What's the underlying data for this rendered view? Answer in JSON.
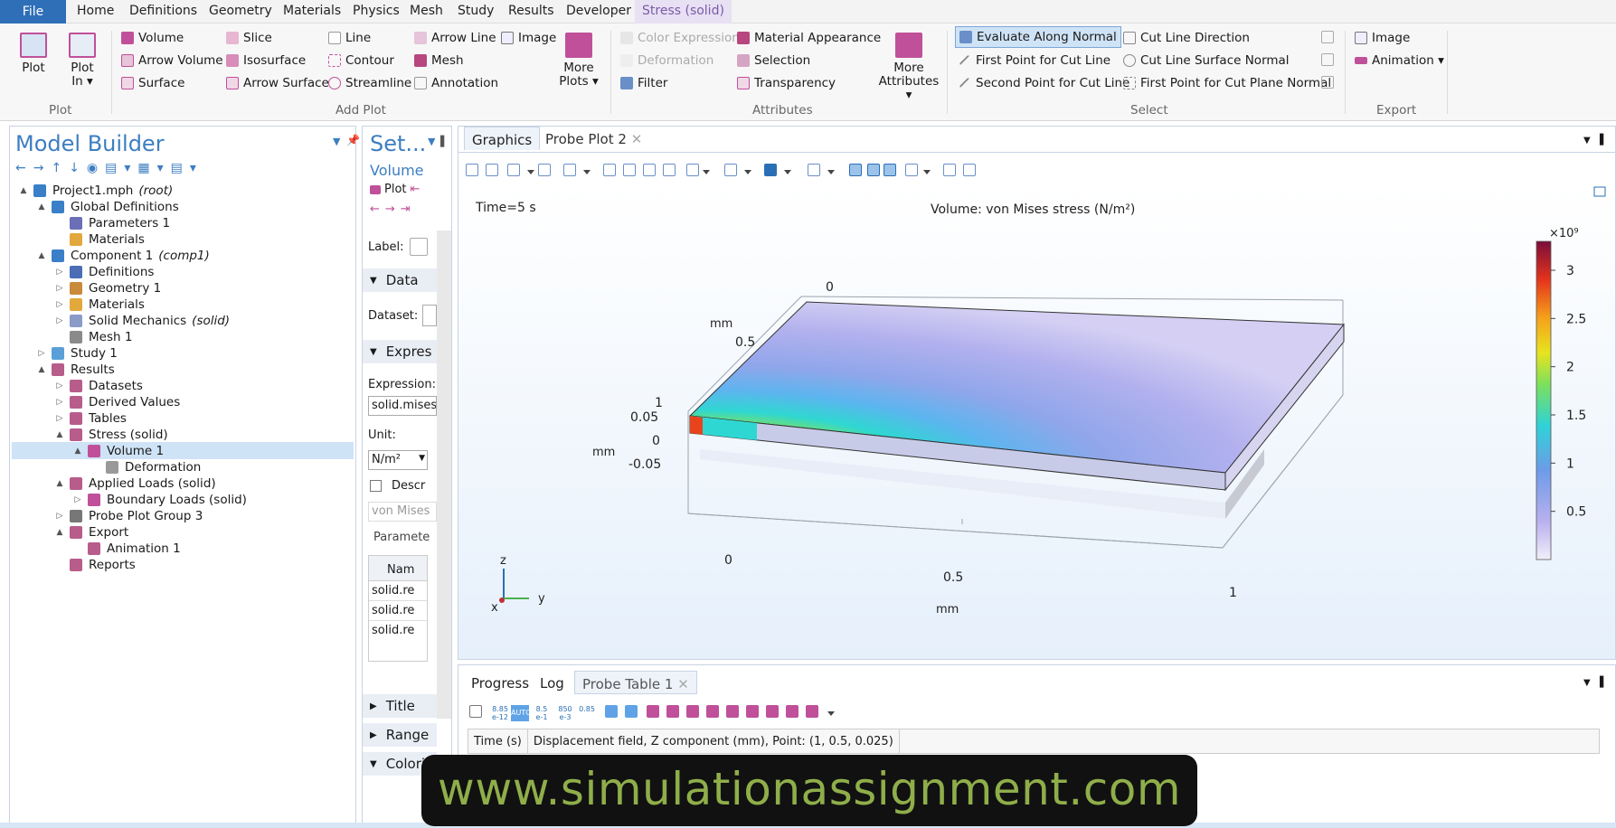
{
  "menu": {
    "file": "File",
    "items": [
      "Home",
      "Definitions",
      "Geometry",
      "Materials",
      "Physics",
      "Mesh",
      "Study",
      "Results",
      "Developer"
    ],
    "context_tab": "Stress (solid)"
  },
  "ribbon": {
    "plot_group": {
      "plot": "Plot",
      "plot_in": "Plot In ▾",
      "label": "Plot"
    },
    "add_plot": {
      "col1": [
        "Volume",
        "Arrow Volume",
        "Surface"
      ],
      "col2": [
        "Slice",
        "Isosurface",
        "Arrow Surface"
      ],
      "col3": [
        "Line",
        "Contour",
        "Streamline"
      ],
      "col4": [
        "Arrow Line",
        "Mesh",
        "Annotation"
      ],
      "image": "Image",
      "more_plots": "More Plots ▾",
      "label": "Add Plot"
    },
    "attributes": {
      "col1": [
        "Color Expression",
        "Deformation",
        "Filter"
      ],
      "col2": [
        "Material Appearance",
        "Selection",
        "Transparency"
      ],
      "more": "More Attributes ▾",
      "label": "Attributes"
    },
    "select": {
      "col1": [
        "Evaluate Along Normal",
        "First Point for Cut Line",
        "Second Point for Cut Line"
      ],
      "col2": [
        "Cut Line Direction",
        "Cut Line Surface Normal",
        "First Point for Cut Plane Normal"
      ],
      "label": "Select"
    },
    "export": {
      "items": [
        "Image",
        "Animation ▾"
      ],
      "label": "Export"
    }
  },
  "model_builder": {
    "title": "Model Builder",
    "tree": [
      {
        "label": "Project1.mph",
        "tag": "(root)",
        "icon": "project-icon",
        "color": "#3a7fc8"
      },
      {
        "label": "Global Definitions",
        "icon": "globe-icon",
        "color": "#3a7fc8"
      },
      {
        "label": "Parameters 1",
        "icon": "parameters-icon",
        "color": "#6a6fb8"
      },
      {
        "label": "Materials",
        "icon": "materials-icon",
        "color": "#e3a83b"
      },
      {
        "label": "Component 1",
        "tag": "(comp1)",
        "icon": "component-icon",
        "color": "#3a7fc8"
      },
      {
        "label": "Definitions",
        "icon": "definitions-icon",
        "color": "#4a6db5"
      },
      {
        "label": "Geometry 1",
        "icon": "geometry-icon",
        "color": "#c98a3b"
      },
      {
        "label": "Materials",
        "icon": "materials-icon",
        "color": "#e3a83b"
      },
      {
        "label": "Solid Mechanics",
        "tag": "(solid)",
        "icon": "solid-mechanics-icon",
        "color": "#8a9bc8"
      },
      {
        "label": "Mesh 1",
        "icon": "mesh-icon",
        "color": "#8a8a8a"
      },
      {
        "label": "Study 1",
        "icon": "study-icon",
        "color": "#5aa0d8"
      },
      {
        "label": "Results",
        "icon": "results-icon",
        "color": "#b85c8c"
      },
      {
        "label": "Datasets",
        "icon": "datasets-icon",
        "color": "#b85c8c"
      },
      {
        "label": "Derived Values",
        "icon": "derived-values-icon",
        "color": "#b85c8c"
      },
      {
        "label": "Tables",
        "icon": "tables-icon",
        "color": "#b85c8c"
      },
      {
        "label": "Stress (solid)",
        "icon": "plot-group-icon",
        "color": "#b85c8c"
      },
      {
        "label": "Volume 1",
        "icon": "volume-icon",
        "color": "#c0509a"
      },
      {
        "label": "Deformation",
        "icon": "deformation-icon",
        "color": "#999"
      },
      {
        "label": "Applied Loads (solid)",
        "icon": "plot-group-icon",
        "color": "#b85c8c"
      },
      {
        "label": "Boundary Loads (solid)",
        "icon": "volume-icon",
        "color": "#c0509a"
      },
      {
        "label": "Probe Plot Group 3",
        "icon": "probe-icon",
        "color": "#777"
      },
      {
        "label": "Export",
        "icon": "export-icon",
        "color": "#b85c8c"
      },
      {
        "label": "Animation 1",
        "icon": "animation-icon",
        "color": "#b85c8c"
      },
      {
        "label": "Reports",
        "icon": "reports-icon",
        "color": "#b85c8c"
      }
    ]
  },
  "settings": {
    "title": "Set...",
    "subtitle": "Volume",
    "plot_btn": "Plot",
    "label_field": "Label:",
    "data_section": "Data",
    "dataset_label": "Dataset:",
    "expression_section": "Expres",
    "expression_label": "Expression:",
    "expression_value": "solid.mises",
    "unit_label": "Unit:",
    "unit_value": "N/m²",
    "description_label": "Descr",
    "description_value": "von Mises",
    "parameters_label": "Paramete",
    "table_header": "Nam",
    "table_rows": [
      "solid.re",
      "solid.re",
      "solid.re"
    ],
    "title_section": "Title",
    "range_section": "Range",
    "coloring_section": "Colori"
  },
  "graphics": {
    "tabs": [
      "Graphics",
      "Probe Plot 2"
    ],
    "time": "Time=5 s",
    "title": "Volume: von Mises stress (N/m²)",
    "axis": {
      "mm_label": "mm",
      "x_ticks": [
        "0",
        "0.5",
        "1"
      ],
      "y_ticks": [
        "0",
        "0.5",
        "1"
      ],
      "z_ticks": [
        "0.05",
        "0",
        "-0.05"
      ]
    },
    "colorbar": {
      "exponent": "×10⁹",
      "ticks": [
        "3",
        "2.5",
        "2",
        "1.5",
        "1",
        "0.5"
      ],
      "min": 0,
      "max": 3.3
    },
    "triad": {
      "z": "z",
      "y": "y",
      "x": "x"
    }
  },
  "bottom": {
    "tabs": [
      "Progress",
      "Log",
      "Probe Table 1"
    ],
    "table_header": [
      "Time (s)",
      "Displacement field, Z component (mm), Point: (1, 0.5, 0.025)"
    ],
    "precision_buttons": [
      "8.85 e-12",
      "AUTO",
      "8.5 e-1",
      "850 e-3",
      "0.85"
    ]
  },
  "watermark": "www.simulationassignment.com"
}
